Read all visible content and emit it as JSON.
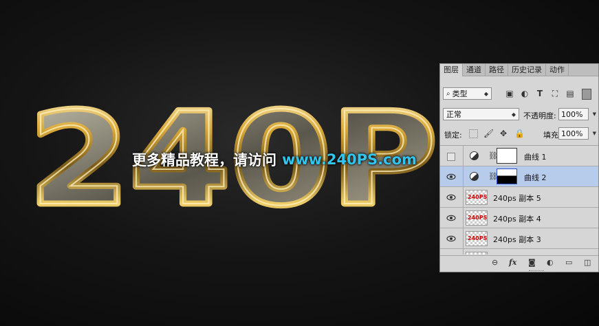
{
  "artwork": {
    "headline": "240P",
    "watermark_cn": "更多精品教程，请访问",
    "watermark_url": "www.240PS.com"
  },
  "colors": {
    "gold": "#e0b640",
    "url_blue": "#33c4ee",
    "selected_row": "#b7ccea"
  },
  "panel": {
    "tabs": [
      "图层",
      "通道",
      "路径",
      "历史记录",
      "动作"
    ],
    "kind_label": "类型",
    "blend_mode": "正常",
    "opacity_label": "不透明度:",
    "opacity_value": "100%",
    "lock_label": "锁定:",
    "fill_label": "填充:",
    "fill_value": "100%",
    "layers": [
      {
        "name": "曲线 1",
        "visible": false,
        "type": "curves",
        "selected": false
      },
      {
        "name": "曲线 2",
        "visible": true,
        "type": "curves",
        "selected": true
      },
      {
        "name": "240ps 副本 5",
        "visible": true,
        "type": "pixel",
        "thumb_text": "240PS"
      },
      {
        "name": "240ps 副本 4",
        "visible": true,
        "type": "pixel",
        "thumb_text": "240PS"
      },
      {
        "name": "240ps 副本 3",
        "visible": true,
        "type": "pixel",
        "thumb_text": "240PS"
      }
    ],
    "bottom_icons": [
      "link-icon",
      "fx-icon",
      "mask-icon",
      "adjustment-icon",
      "folder-icon",
      "new-layer-icon"
    ],
    "fx_label": "fx"
  }
}
